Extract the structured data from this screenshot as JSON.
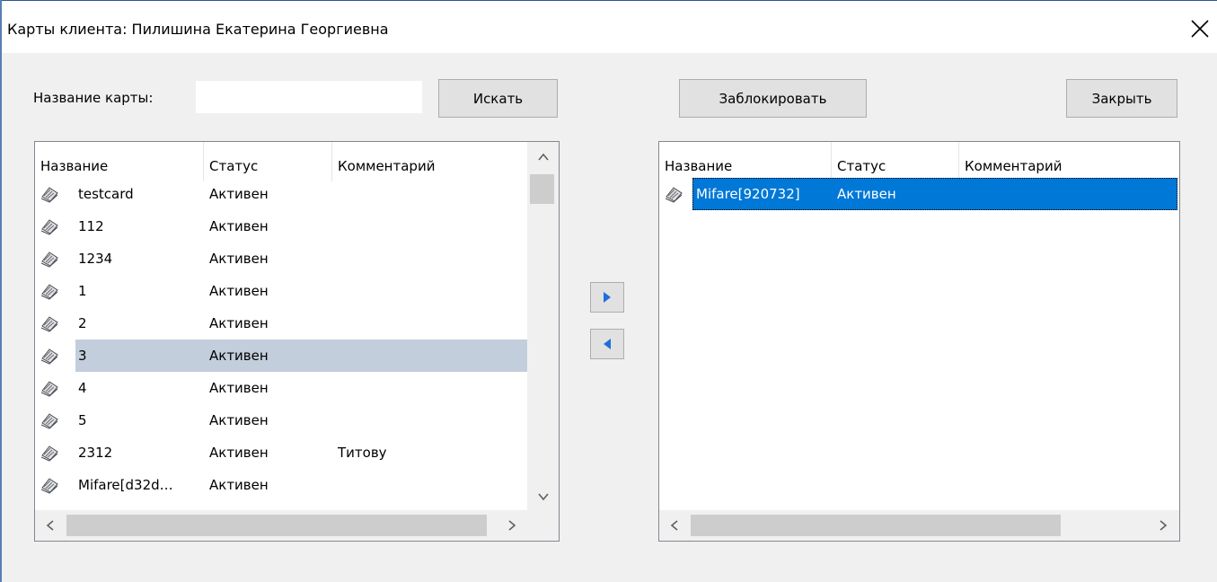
{
  "window": {
    "title": "Карты клиента: Пилишина Екатерина Георгиевна"
  },
  "search": {
    "label": "Название карты:",
    "value": "",
    "placeholder": "",
    "button_label": "Искать"
  },
  "toolbar": {
    "block_label": "Заблокировать",
    "close_label": "Закрыть"
  },
  "left_list": {
    "columns": [
      "Название",
      "Статус",
      "Комментарий"
    ],
    "rows": [
      {
        "name": "testcard",
        "status": "Активен",
        "comment": ""
      },
      {
        "name": "112",
        "status": "Активен",
        "comment": ""
      },
      {
        "name": "1234",
        "status": "Активен",
        "comment": ""
      },
      {
        "name": "1",
        "status": "Активен",
        "comment": ""
      },
      {
        "name": "2",
        "status": "Активен",
        "comment": ""
      },
      {
        "name": "3",
        "status": "Активен",
        "comment": "",
        "selected": true
      },
      {
        "name": "4",
        "status": "Активен",
        "comment": ""
      },
      {
        "name": "5",
        "status": "Активен",
        "comment": ""
      },
      {
        "name": "2312",
        "status": "Активен",
        "comment": "Титову"
      },
      {
        "name": "Mifare[d32d…",
        "status": "Активен",
        "comment": ""
      }
    ]
  },
  "right_list": {
    "columns": [
      "Название",
      "Статус",
      "Комментарий"
    ],
    "rows": [
      {
        "name": "Mifare[920732]",
        "status": "Активен",
        "comment": "",
        "selected": true
      }
    ]
  },
  "icons": {
    "card": "card-icon",
    "move_right": "arrow-right-icon",
    "move_left": "arrow-left-icon",
    "close": "close-icon"
  },
  "colors": {
    "selection_blue": "#0078d7",
    "selection_grey": "#c3cedc",
    "arrow_blue": "#1e6fd9"
  }
}
